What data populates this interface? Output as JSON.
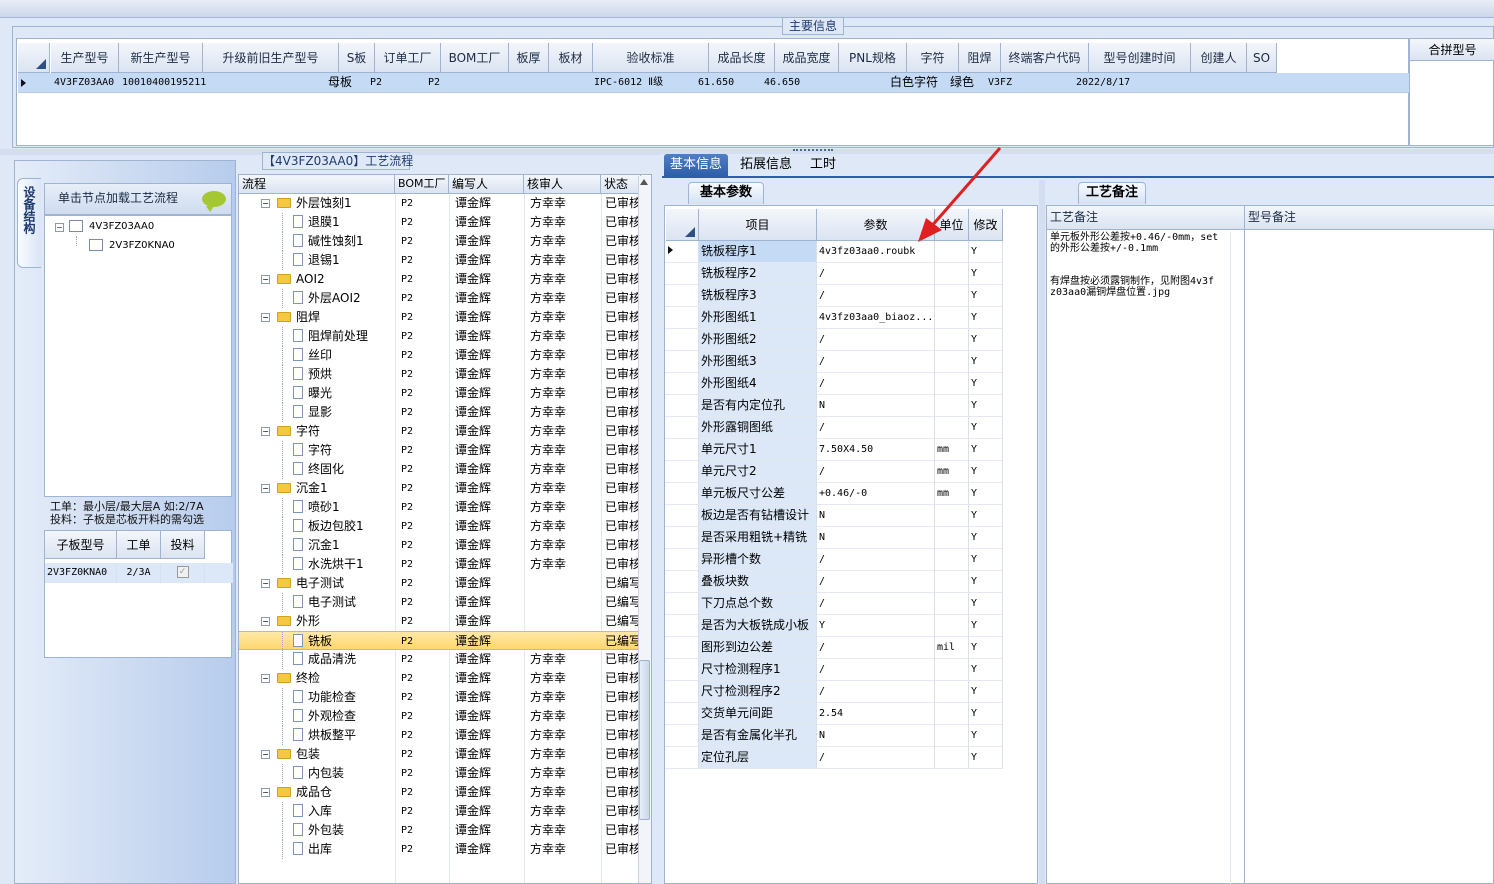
{
  "main_info": {
    "title": "主要信息",
    "columns": [
      "生产型号",
      "新生产型号",
      "升级前旧生产型号",
      "S板",
      "订单工厂",
      "BOM工厂",
      "板厚",
      "板材",
      "验收标准",
      "成品长度",
      "成品宽度",
      "PNL规格",
      "字符",
      "阻焊",
      "终端客户代码",
      "型号创建时间",
      "创建人",
      "SO"
    ],
    "row": [
      "4V3FZ03AA0",
      "10010400195211",
      "",
      "母板",
      "P2",
      "P2",
      "",
      "",
      "IPC-6012 Ⅱ级",
      "61.650",
      "46.650",
      "",
      "白色字符",
      "绿色",
      "V3FZ",
      "2022/8/17",
      "",
      ""
    ],
    "merge_header": "合拼型号"
  },
  "left_panel": {
    "vertical_tab": "设备结构",
    "tree_header": "单击节点加载工艺流程",
    "tree": [
      "4V3FZ03AA0",
      "2V3FZ0KNA0"
    ],
    "note_line1": "工单：最小层/最大层A 如:2/7A",
    "note_line2": "投料：子板是芯板开料的需勾选",
    "sub_grid": {
      "columns": [
        "子板型号",
        "工单",
        "投料"
      ],
      "row": [
        "2V3FZ0KNA0",
        "2/3A",
        ""
      ]
    }
  },
  "process": {
    "title": "【4V3FZ03AA0】工艺流程",
    "columns": [
      "流程",
      "BOM工厂",
      "编写人",
      "核审人",
      "状态"
    ],
    "rows": [
      {
        "name": "外层蚀刻1",
        "level": 0,
        "bom": "P2",
        "writer": "谭金辉",
        "reviewer": "方幸幸",
        "status": "已审核"
      },
      {
        "name": "退膜1",
        "level": 1,
        "bom": "P2",
        "writer": "谭金辉",
        "reviewer": "方幸幸",
        "status": "已审核"
      },
      {
        "name": "碱性蚀刻1",
        "level": 1,
        "bom": "P2",
        "writer": "谭金辉",
        "reviewer": "方幸幸",
        "status": "已审核"
      },
      {
        "name": "退锡1",
        "level": 1,
        "bom": "P2",
        "writer": "谭金辉",
        "reviewer": "方幸幸",
        "status": "已审核"
      },
      {
        "name": "AOI2",
        "level": 0,
        "bom": "P2",
        "writer": "谭金辉",
        "reviewer": "方幸幸",
        "status": "已审核"
      },
      {
        "name": "外层AOI2",
        "level": 1,
        "bom": "P2",
        "writer": "谭金辉",
        "reviewer": "方幸幸",
        "status": "已审核"
      },
      {
        "name": "阻焊",
        "level": 0,
        "bom": "P2",
        "writer": "谭金辉",
        "reviewer": "方幸幸",
        "status": "已审核"
      },
      {
        "name": "阻焊前处理",
        "level": 1,
        "bom": "P2",
        "writer": "谭金辉",
        "reviewer": "方幸幸",
        "status": "已审核"
      },
      {
        "name": "丝印",
        "level": 1,
        "bom": "P2",
        "writer": "谭金辉",
        "reviewer": "方幸幸",
        "status": "已审核"
      },
      {
        "name": "预烘",
        "level": 1,
        "bom": "P2",
        "writer": "谭金辉",
        "reviewer": "方幸幸",
        "status": "已审核"
      },
      {
        "name": "曝光",
        "level": 1,
        "bom": "P2",
        "writer": "谭金辉",
        "reviewer": "方幸幸",
        "status": "已审核"
      },
      {
        "name": "显影",
        "level": 1,
        "bom": "P2",
        "writer": "谭金辉",
        "reviewer": "方幸幸",
        "status": "已审核"
      },
      {
        "name": "字符",
        "level": 0,
        "bom": "P2",
        "writer": "谭金辉",
        "reviewer": "方幸幸",
        "status": "已审核"
      },
      {
        "name": "字符",
        "level": 1,
        "bom": "P2",
        "writer": "谭金辉",
        "reviewer": "方幸幸",
        "status": "已审核"
      },
      {
        "name": "终固化",
        "level": 1,
        "bom": "P2",
        "writer": "谭金辉",
        "reviewer": "方幸幸",
        "status": "已审核"
      },
      {
        "name": "沉金1",
        "level": 0,
        "bom": "P2",
        "writer": "谭金辉",
        "reviewer": "方幸幸",
        "status": "已审核"
      },
      {
        "name": "喷砂1",
        "level": 1,
        "bom": "P2",
        "writer": "谭金辉",
        "reviewer": "方幸幸",
        "status": "已审核"
      },
      {
        "name": "板边包胶1",
        "level": 1,
        "bom": "P2",
        "writer": "谭金辉",
        "reviewer": "方幸幸",
        "status": "已审核"
      },
      {
        "name": "沉金1",
        "level": 1,
        "bom": "P2",
        "writer": "谭金辉",
        "reviewer": "方幸幸",
        "status": "已审核"
      },
      {
        "name": "水洗烘干1",
        "level": 1,
        "bom": "P2",
        "writer": "谭金辉",
        "reviewer": "方幸幸",
        "status": "已审核"
      },
      {
        "name": "电子测试",
        "level": 0,
        "bom": "P2",
        "writer": "谭金辉",
        "reviewer": "",
        "status": "已编写"
      },
      {
        "name": "电子测试",
        "level": 1,
        "bom": "P2",
        "writer": "谭金辉",
        "reviewer": "",
        "status": "已编写"
      },
      {
        "name": "外形",
        "level": 0,
        "bom": "P2",
        "writer": "谭金辉",
        "reviewer": "",
        "status": "已编写"
      },
      {
        "name": "铣板",
        "level": 1,
        "bom": "P2",
        "writer": "谭金辉",
        "reviewer": "",
        "status": "已编写",
        "selected": true
      },
      {
        "name": "成品清洗",
        "level": 1,
        "bom": "P2",
        "writer": "谭金辉",
        "reviewer": "方幸幸",
        "status": "已审核"
      },
      {
        "name": "终检",
        "level": 0,
        "bom": "P2",
        "writer": "谭金辉",
        "reviewer": "方幸幸",
        "status": "已审核"
      },
      {
        "name": "功能检查",
        "level": 1,
        "bom": "P2",
        "writer": "谭金辉",
        "reviewer": "方幸幸",
        "status": "已审核"
      },
      {
        "name": "外观检查",
        "level": 1,
        "bom": "P2",
        "writer": "谭金辉",
        "reviewer": "方幸幸",
        "status": "已审核"
      },
      {
        "name": "烘板整平",
        "level": 1,
        "bom": "P2",
        "writer": "谭金辉",
        "reviewer": "方幸幸",
        "status": "已审核"
      },
      {
        "name": "包装",
        "level": 0,
        "bom": "P2",
        "writer": "谭金辉",
        "reviewer": "方幸幸",
        "status": "已审核"
      },
      {
        "name": "内包装",
        "level": 1,
        "bom": "P2",
        "writer": "谭金辉",
        "reviewer": "方幸幸",
        "status": "已审核"
      },
      {
        "name": "成品仓",
        "level": 0,
        "bom": "P2",
        "writer": "谭金辉",
        "reviewer": "方幸幸",
        "status": "已审核"
      },
      {
        "name": "入库",
        "level": 1,
        "bom": "P2",
        "writer": "谭金辉",
        "reviewer": "方幸幸",
        "status": "已审核"
      },
      {
        "name": "外包装",
        "level": 1,
        "bom": "P2",
        "writer": "谭金辉",
        "reviewer": "方幸幸",
        "status": "已审核"
      },
      {
        "name": "出库",
        "level": 1,
        "bom": "P2",
        "writer": "谭金辉",
        "reviewer": "方幸幸",
        "status": "已审核"
      }
    ]
  },
  "tabs": [
    "基本信息",
    "拓展信息",
    "工时"
  ],
  "basic_params": {
    "tab": "基本参数",
    "columns": [
      "项目",
      "参数",
      "单位",
      "修改"
    ],
    "rows": [
      [
        "铣板程序1",
        "4v3fz03aa0.roubk",
        "",
        "Y"
      ],
      [
        "铣板程序2",
        "/",
        "",
        "Y"
      ],
      [
        "铣板程序3",
        "/",
        "",
        "Y"
      ],
      [
        "外形图纸1",
        "4v3fz03aa0_biaoz...",
        "",
        "Y"
      ],
      [
        "外形图纸2",
        "/",
        "",
        "Y"
      ],
      [
        "外形图纸3",
        "/",
        "",
        "Y"
      ],
      [
        "外形图纸4",
        "/",
        "",
        "Y"
      ],
      [
        "是否有内定位孔",
        "N",
        "",
        "Y"
      ],
      [
        "外形露铜图纸",
        "/",
        "",
        "Y"
      ],
      [
        "单元尺寸1",
        "7.50X4.50",
        "mm",
        "Y"
      ],
      [
        "单元尺寸2",
        "/",
        "mm",
        "Y"
      ],
      [
        "单元板尺寸公差",
        "+0.46/-0",
        "mm",
        "Y"
      ],
      [
        "板边是否有钻槽设计",
        "N",
        "",
        "Y"
      ],
      [
        "是否采用粗铣+精铣",
        "N",
        "",
        "Y"
      ],
      [
        "异形槽个数",
        "/",
        "",
        "Y"
      ],
      [
        "叠板块数",
        "/",
        "",
        "Y"
      ],
      [
        "下刀点总个数",
        "/",
        "",
        "Y"
      ],
      [
        "是否为大板铣成小板",
        "Y",
        "",
        "Y"
      ],
      [
        "图形到边公差",
        "/",
        "mil",
        "Y"
      ],
      [
        "尺寸检测程序1",
        "/",
        "",
        "Y"
      ],
      [
        "尺寸检测程序2",
        "/",
        "",
        "Y"
      ],
      [
        "交货单元间距",
        "2.54",
        "",
        "Y"
      ],
      [
        "是否有金属化半孔",
        "N",
        "",
        "Y"
      ],
      [
        "定位孔层",
        "/",
        "",
        "Y"
      ]
    ]
  },
  "craft_remarks": {
    "tab": "工艺备注",
    "col1": "工艺备注",
    "col2": "型号备注",
    "text": "单元板外形公差按+0.46/-0mm，set的外形公差按+/-0.1mm\n\n\n有焊盘按必须露铜制作，见附图4v3fz03aa0漏铜焊盘位置.jpg"
  },
  "colors": {
    "accent": "#2d5ea8",
    "selection": "#ffd66e",
    "row_highlight": "#c5dbf5",
    "arrow": "#e02020"
  }
}
